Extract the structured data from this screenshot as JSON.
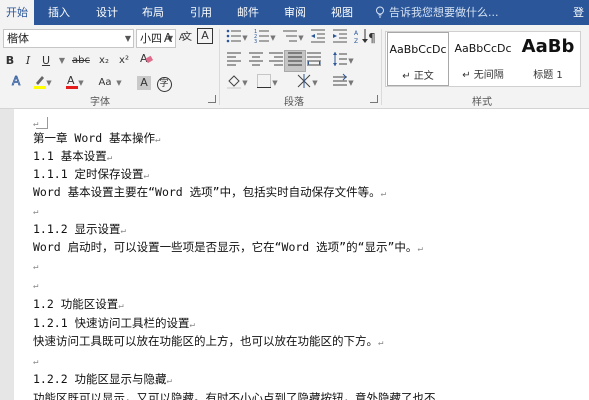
{
  "menu": {
    "tabs": [
      "开始",
      "插入",
      "设计",
      "布局",
      "引用",
      "邮件",
      "审阅",
      "视图"
    ],
    "tellme": "告诉我您想要做什么...",
    "login": "登"
  },
  "ribbon": {
    "font_name": "楷体",
    "font_size": "小四",
    "font_group_label": "字体",
    "paragraph_group_label": "段落",
    "styles_group_label": "样式",
    "styles": [
      {
        "preview": "AaBbCcDc",
        "name": "↵ 正文"
      },
      {
        "preview": "AaBbCcDc",
        "name": "↵ 无间隔"
      },
      {
        "preview": "AaBb",
        "name": "标题 1"
      }
    ],
    "icons": {
      "grow": "A",
      "shrink": "A",
      "phonetic": "文",
      "bordered": "A",
      "bold": "B",
      "italic": "I",
      "underline": "U",
      "strike": "abc",
      "sub": "x₂",
      "sup": "x²",
      "clear": "A",
      "case": "Aa",
      "charshade": "A",
      "enclosed": "字"
    }
  },
  "paragraph_mark": "↵",
  "document": {
    "lines": [
      "",
      "第一章 Word 基本操作",
      "1.1 基本设置",
      "1.1.1 定时保存设置",
      "Word 基本设置主要在“Word 选项”中，包括实时自动保存文件等。",
      "",
      "1.1.2 显示设置",
      "Word 启动时，可以设置一些项是否显示，它在“Word 选项”的“显示”中。",
      "",
      "",
      "1.2 功能区设置",
      "1.2.1 快速访问工具栏的设置",
      "快速访问工具既可以放在功能区的上方，也可以放在功能区的下方。",
      "",
      "1.2.2 功能区显示与隐藏",
      "功能区既可以显示，又可以隐藏。有时不小心点到了隐藏按钮，意外隐藏了也不"
    ]
  }
}
